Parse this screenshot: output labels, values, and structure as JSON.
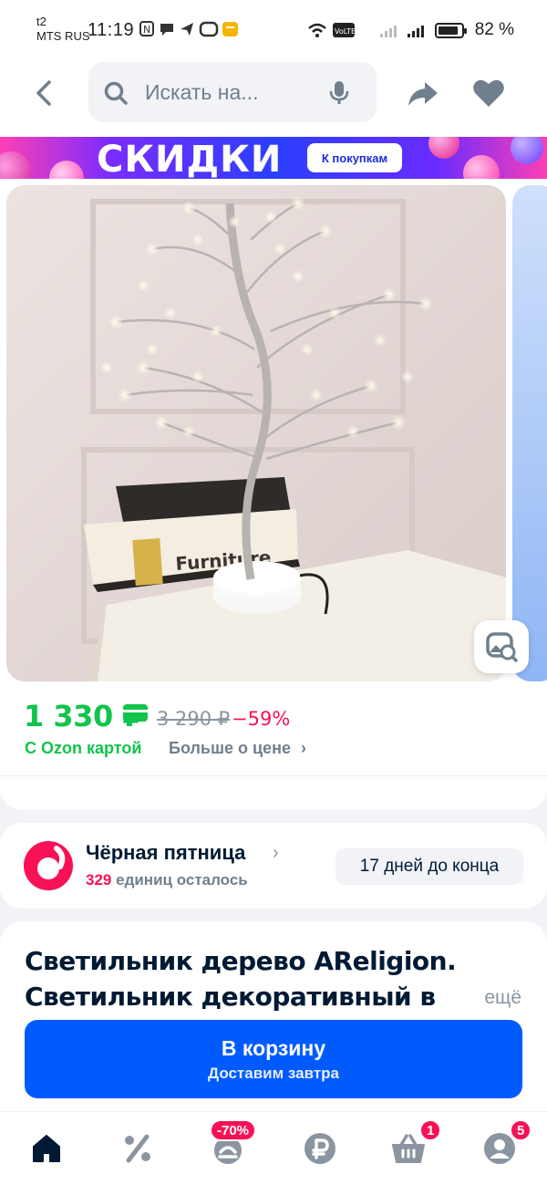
{
  "status_bar": {
    "carrier_line1": "t2",
    "carrier_line2": "MTS RUS",
    "time": "11:19",
    "battery_percent": "82 %",
    "battery_level": 0.82
  },
  "header": {
    "search_placeholder": "Искать на..."
  },
  "promo": {
    "title": "СКИДКИ",
    "button_label": "К покупкам"
  },
  "gallery": {
    "photo_text": "Furniture"
  },
  "price": {
    "current": "1 330 ₽",
    "old": "3 290 ₽",
    "discount": "−59%",
    "card_label": "С Ozon картой",
    "more_label": "Больше о цене"
  },
  "black_friday": {
    "title": "Чёрная пятница",
    "count": "329",
    "count_suffix": "единиц осталось",
    "days_left": "17 дней до конца"
  },
  "product": {
    "title": "Светильник дерево AReligion. Светильник декоративный в",
    "more_label": "ещё"
  },
  "cart_button": {
    "label": "В корзину",
    "sublabel": "Доставим завтра"
  },
  "tabs": [
    {
      "name": "home",
      "icon": "home-icon",
      "active": true
    },
    {
      "name": "sale",
      "icon": "percent-icon",
      "active": false
    },
    {
      "name": "fresh",
      "icon": "fresh-icon",
      "active": false,
      "badge": "-70%"
    },
    {
      "name": "finance",
      "icon": "ruble-icon",
      "active": false
    },
    {
      "name": "cart",
      "icon": "basket-icon",
      "active": false,
      "badge": "1"
    },
    {
      "name": "profile",
      "icon": "profile-icon",
      "active": false,
      "badge": "5"
    }
  ],
  "colors": {
    "accent_blue": "#005bff",
    "price_green": "#10c44c",
    "sale_red": "#f91155",
    "text_dark": "#001a34",
    "text_gray": "#707f8d"
  }
}
